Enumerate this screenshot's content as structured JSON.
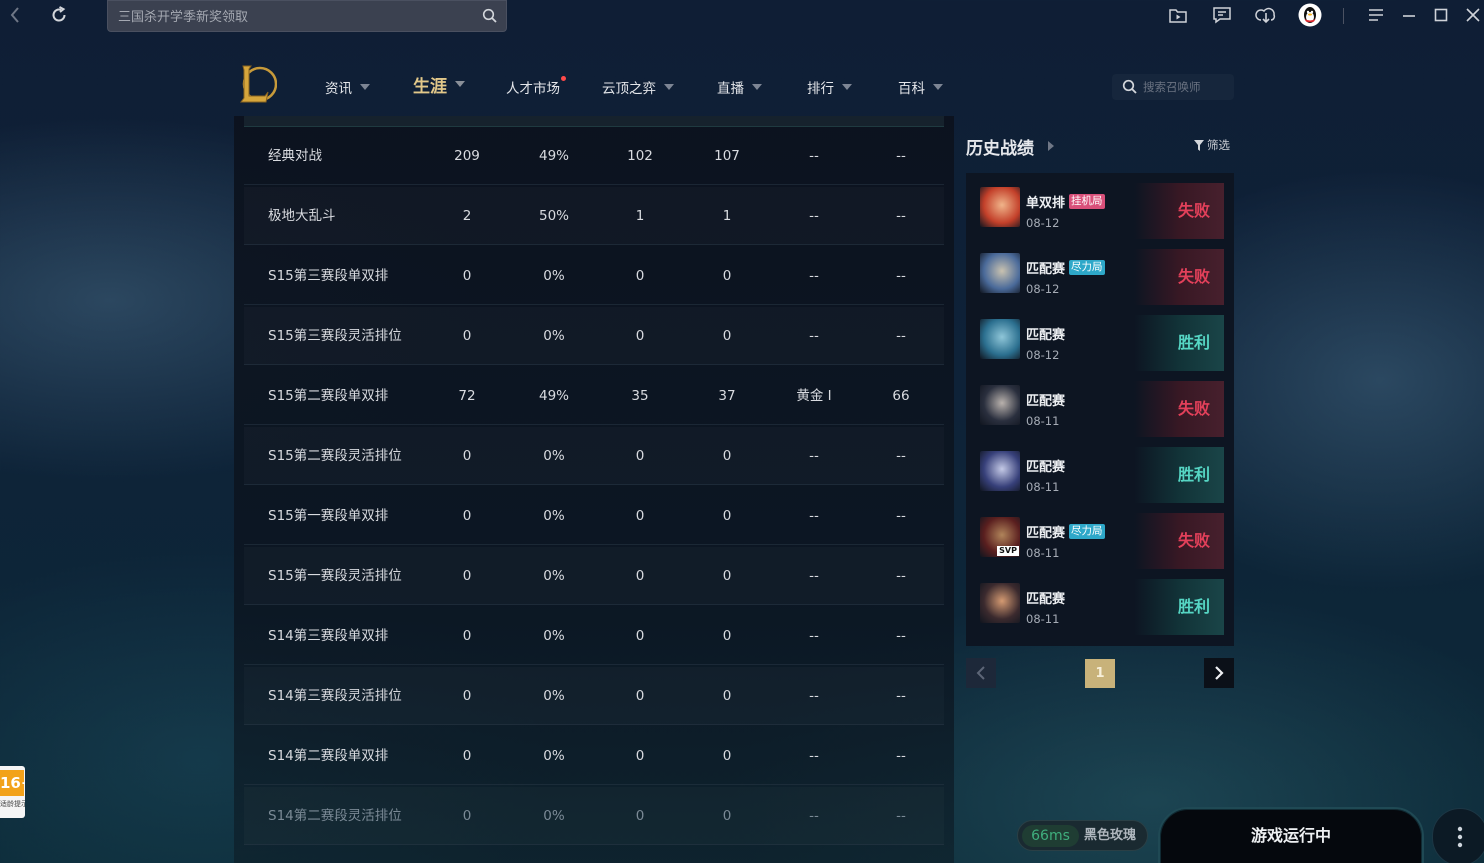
{
  "topbar": {
    "search_placeholder": "三国杀开学季新奖领取",
    "icons": [
      "back-arrow-icon",
      "refresh-icon",
      "search-icon",
      "folder-play-icon",
      "message-icon",
      "download-icon",
      "qq-penguin-avatar",
      "menu-icon",
      "minimize-icon",
      "maximize-icon",
      "close-icon"
    ]
  },
  "nav": {
    "items": [
      {
        "label": "资讯",
        "dropdown": true
      },
      {
        "label": "生涯",
        "dropdown": true,
        "active": true
      },
      {
        "label": "人才市场",
        "badge_dot": true
      },
      {
        "label": "云顶之弈",
        "dropdown": true
      },
      {
        "label": "直播",
        "dropdown": true
      },
      {
        "label": "排行",
        "dropdown": true
      },
      {
        "label": "百科",
        "dropdown": true
      }
    ],
    "summoner_search_placeholder": "搜索召唤师"
  },
  "stats_table": {
    "rows": [
      {
        "mode": "经典对战",
        "total": "209",
        "rate": "49%",
        "wins": "102",
        "losses": "107",
        "tier": "--",
        "lp": "--"
      },
      {
        "mode": "极地大乱斗",
        "total": "2",
        "rate": "50%",
        "wins": "1",
        "losses": "1",
        "tier": "--",
        "lp": "--"
      },
      {
        "mode": "S15第三赛段单双排",
        "total": "0",
        "rate": "0%",
        "wins": "0",
        "losses": "0",
        "tier": "--",
        "lp": "--"
      },
      {
        "mode": "S15第三赛段灵活排位",
        "total": "0",
        "rate": "0%",
        "wins": "0",
        "losses": "0",
        "tier": "--",
        "lp": "--"
      },
      {
        "mode": "S15第二赛段单双排",
        "total": "72",
        "rate": "49%",
        "wins": "35",
        "losses": "37",
        "tier": "黄金 I",
        "lp": "66"
      },
      {
        "mode": "S15第二赛段灵活排位",
        "total": "0",
        "rate": "0%",
        "wins": "0",
        "losses": "0",
        "tier": "--",
        "lp": "--"
      },
      {
        "mode": "S15第一赛段单双排",
        "total": "0",
        "rate": "0%",
        "wins": "0",
        "losses": "0",
        "tier": "--",
        "lp": "--"
      },
      {
        "mode": "S15第一赛段灵活排位",
        "total": "0",
        "rate": "0%",
        "wins": "0",
        "losses": "0",
        "tier": "--",
        "lp": "--"
      },
      {
        "mode": "S14第三赛段单双排",
        "total": "0",
        "rate": "0%",
        "wins": "0",
        "losses": "0",
        "tier": "--",
        "lp": "--"
      },
      {
        "mode": "S14第三赛段灵活排位",
        "total": "0",
        "rate": "0%",
        "wins": "0",
        "losses": "0",
        "tier": "--",
        "lp": "--"
      },
      {
        "mode": "S14第二赛段单双排",
        "total": "0",
        "rate": "0%",
        "wins": "0",
        "losses": "0",
        "tier": "--",
        "lp": "--"
      },
      {
        "mode": "S14第二赛段灵活排位",
        "total": "0",
        "rate": "0%",
        "wins": "0",
        "losses": "0",
        "tier": "--",
        "lp": "--"
      }
    ]
  },
  "history": {
    "title": "历史战绩",
    "filter_label": "筛选",
    "matches": [
      {
        "mode": "单双排",
        "tag": "挂机局",
        "tag_type": "afk",
        "date": "08-12",
        "result": "失败",
        "outcome": "lose",
        "champ_colors": [
          "#c3402a",
          "#f0b48a"
        ]
      },
      {
        "mode": "匹配赛",
        "tag": "尽力局",
        "tag_type": "effort",
        "date": "08-12",
        "result": "失败",
        "outcome": "lose",
        "champ_colors": [
          "#4a6a9a",
          "#c9c2b0"
        ]
      },
      {
        "mode": "匹配赛",
        "tag": "",
        "tag_type": "",
        "date": "08-12",
        "result": "胜利",
        "outcome": "win",
        "champ_colors": [
          "#2b6f8f",
          "#8fc6d8"
        ]
      },
      {
        "mode": "匹配赛",
        "tag": "",
        "tag_type": "",
        "date": "08-11",
        "result": "失败",
        "outcome": "lose",
        "champ_colors": [
          "#2a2f3e",
          "#b9b2ad"
        ]
      },
      {
        "mode": "匹配赛",
        "tag": "",
        "tag_type": "",
        "date": "08-11",
        "result": "胜利",
        "outcome": "win",
        "champ_colors": [
          "#37407a",
          "#c4c9e6"
        ]
      },
      {
        "mode": "匹配赛",
        "tag": "尽力局",
        "tag_type": "effort",
        "date": "08-11",
        "result": "失败",
        "outcome": "lose",
        "champ_colors": [
          "#5a1f1f",
          "#b0845a"
        ]
      },
      {
        "mode": "匹配赛",
        "tag": "",
        "tag_type": "",
        "date": "08-11",
        "result": "胜利",
        "outcome": "win",
        "champ_colors": [
          "#3b2a2e",
          "#d49a72"
        ]
      }
    ],
    "champ_badge": "SVP",
    "pager": {
      "current": "1"
    }
  },
  "bottom": {
    "age_rating": "16+",
    "age_note": "适龄提示",
    "ping": "66ms",
    "server": "黑色玫瑰",
    "game_button": "游戏运行中"
  }
}
